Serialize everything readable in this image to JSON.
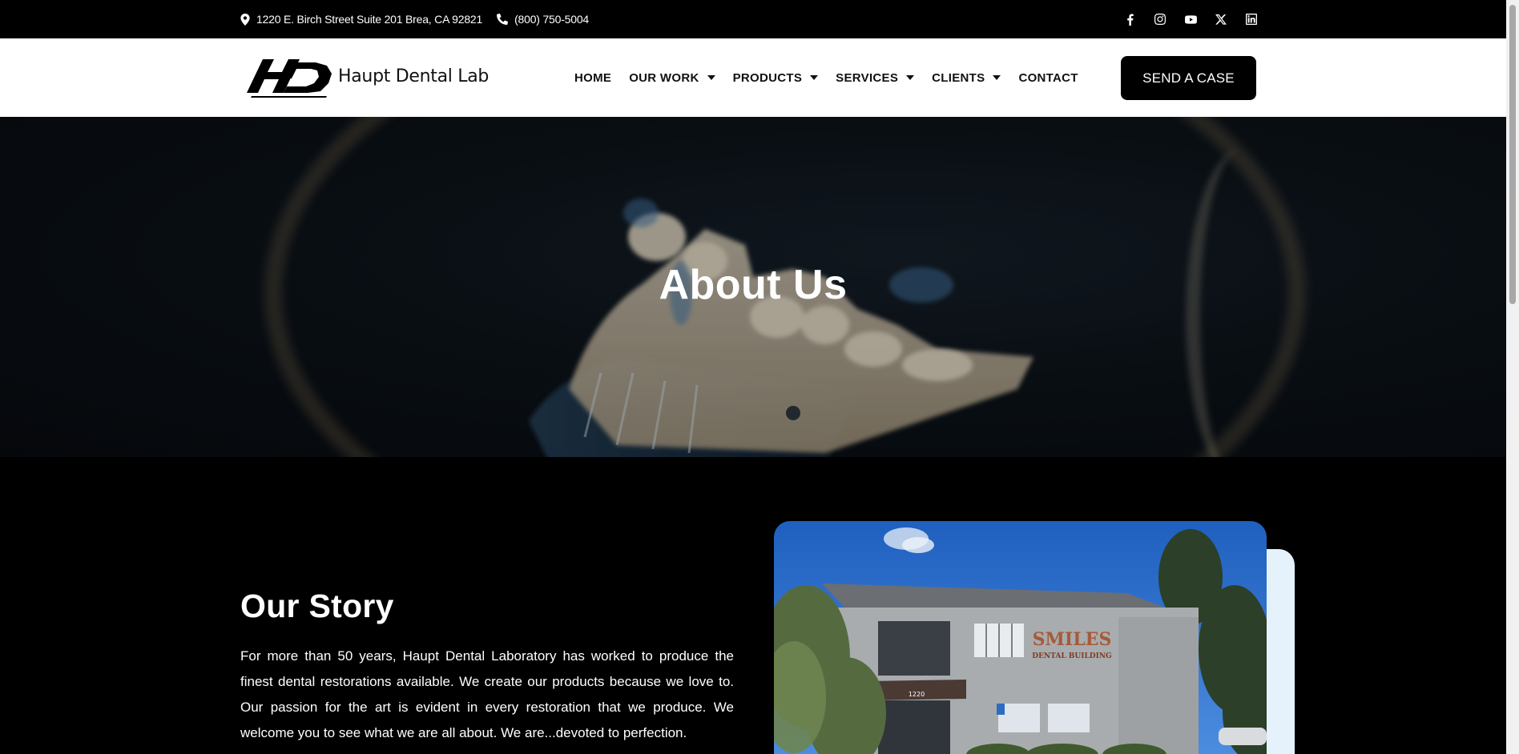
{
  "topbar": {
    "address": "1220 E. Birch Street Suite 201 Brea, CA 92821",
    "phone": "(800) 750-5004",
    "social": [
      "facebook-icon",
      "instagram-icon",
      "youtube-icon",
      "x-icon",
      "linkedin-icon"
    ]
  },
  "header": {
    "logo_text": "Haupt Dental Lab",
    "nav": [
      {
        "label": "HOME",
        "dropdown": false
      },
      {
        "label": "OUR WORK",
        "dropdown": true
      },
      {
        "label": "PRODUCTS",
        "dropdown": true
      },
      {
        "label": "SERVICES",
        "dropdown": true
      },
      {
        "label": "CLIENTS",
        "dropdown": true
      },
      {
        "label": "CONTACT",
        "dropdown": false
      }
    ],
    "cta_label": "SEND A CASE"
  },
  "hero": {
    "title": "About Us"
  },
  "story": {
    "heading": "Our Story",
    "body": "For more than 50 years, Haupt Dental Laboratory has worked to produce the finest dental restorations available. We create our products because we love to. Our passion for the art is evident in every restoration that we produce. We welcome you to see what we are all about. We are...devoted to perfection.",
    "photo_sign": "SMILES",
    "photo_sign_sub": "DENTAL BUILDING",
    "photo_number": "1220"
  },
  "colors": {
    "topbar_bg": "#000000",
    "header_bg": "#ffffff",
    "cta_bg": "#000000",
    "story_bg": "#000000",
    "photo_accent": "#e6f2fb"
  }
}
